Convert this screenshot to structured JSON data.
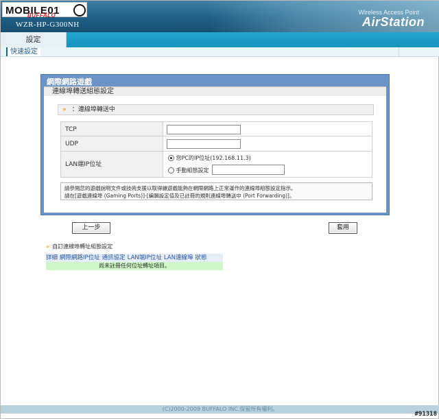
{
  "header": {
    "logo_text": "MOBILE01",
    "logo_sub": "BUFFALO",
    "model": "WZR-HP-G300NH",
    "wap": "Wireless Access Point",
    "brand": "AirStation"
  },
  "nav": {
    "tab_label": "設定",
    "subnav_item": "快速設定"
  },
  "panel": {
    "title": "網際網路遊戲",
    "subtitle": "連線埠轉送組態設定",
    "section_title": "：連線埠轉送中",
    "tcp_label": "TCP",
    "tcp_value": "",
    "udp_label": "UDP",
    "udp_value": "",
    "lan_label": "LAN端IP位址",
    "option_pc": "您PC的IP位址(192.168.11.3)",
    "option_manual": "手動組態設定",
    "manual_value": "",
    "info_line1": "請參閱您的遊戲說明文件或技術支援以取得讓遊戲能夠在網際網路上正常運作的連線埠組態設定指示。",
    "info_line2": "請在[遊戲連線埠 (Gaming Ports)]-[編輯設定值及已註冊的規則連線埠轉送中 (Port Forwarding)]。"
  },
  "buttons": {
    "back": "上一步",
    "apply": "套用"
  },
  "list": {
    "title": "自訂連線埠轉址組態設定",
    "columns": [
      "詳細",
      "網際網路IP位址",
      "通訊協定",
      "LAN端IP位址",
      "LAN連線埠",
      "狀態"
    ],
    "empty": "尚未註冊任何位址轉址項目。"
  },
  "footer": {
    "copyright": "(C)2000-2009 BUFFALO INC.保留所有權利。",
    "watermark": "#91318"
  },
  "colors": {
    "header": "#1f5f86",
    "nav": "#1792bd",
    "panel": "#6a93c8",
    "empty_row": "#cff5c8",
    "accent": "#f19a1a"
  }
}
